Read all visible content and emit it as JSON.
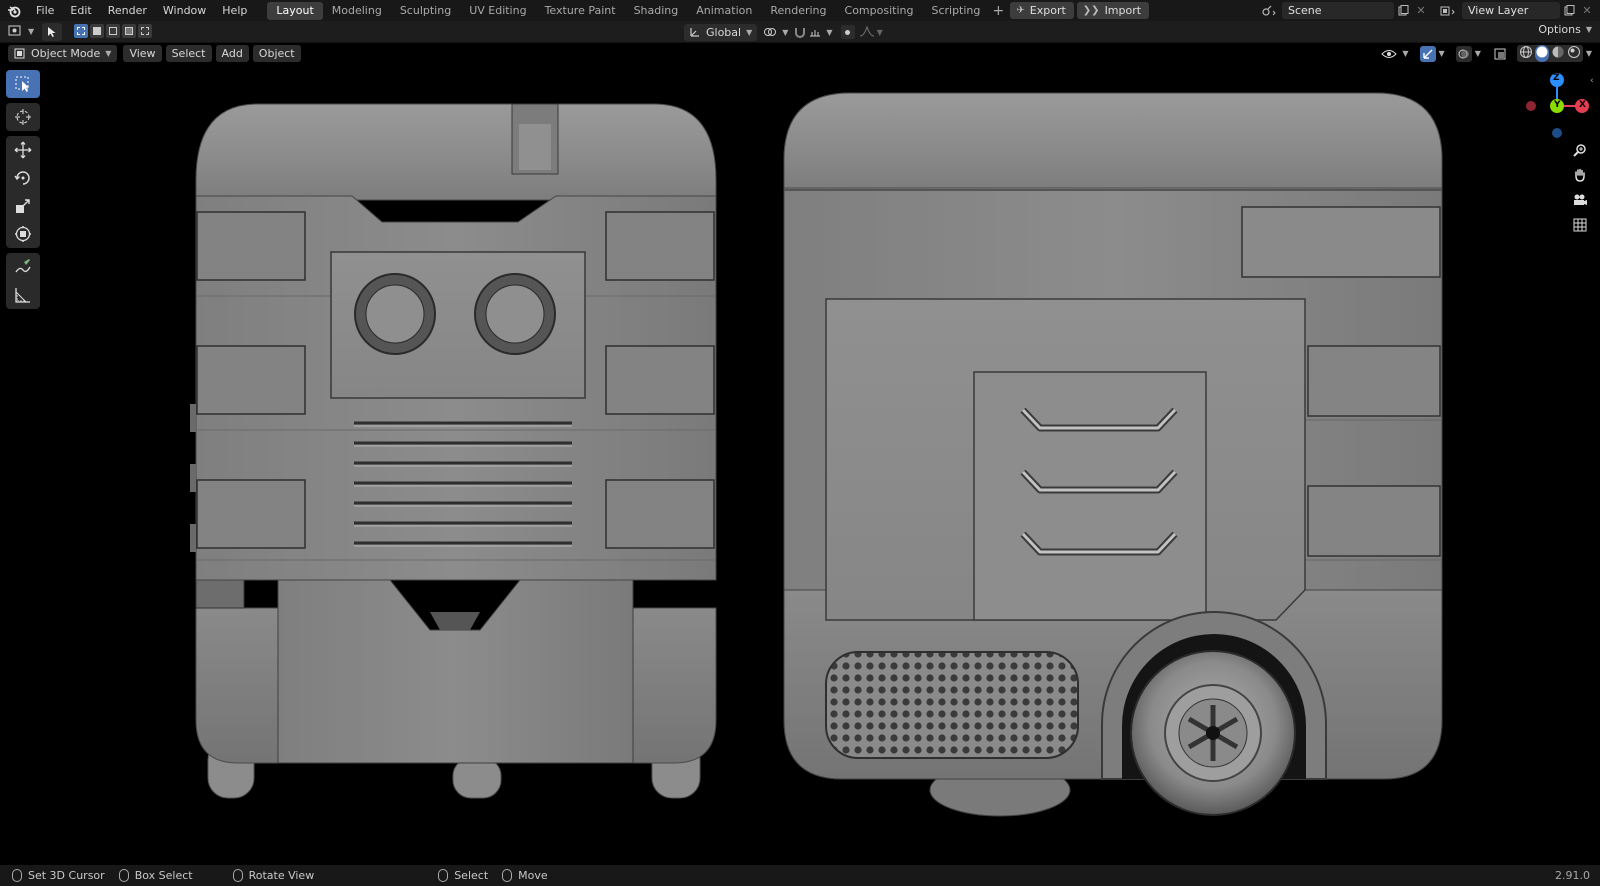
{
  "menu": [
    "File",
    "Edit",
    "Render",
    "Window",
    "Help"
  ],
  "workspaces": [
    "Layout",
    "Modeling",
    "Sculpting",
    "UV Editing",
    "Texture Paint",
    "Shading",
    "Animation",
    "Rendering",
    "Compositing",
    "Scripting"
  ],
  "active_workspace": "Layout",
  "top_buttons": {
    "export": "Export",
    "import": "Import"
  },
  "scene": {
    "value": "Scene"
  },
  "view_layer": {
    "value": "View Layer"
  },
  "header": {
    "mode": "Object Mode",
    "view": "View",
    "select": "Select",
    "add": "Add",
    "object": "Object",
    "transform_orientation": "Global",
    "options": "Options"
  },
  "gizmo": {
    "z": "Z",
    "y": "Y",
    "x": "X"
  },
  "status": {
    "set_cursor": "Set 3D Cursor",
    "box_select": "Box Select",
    "rotate_view": "Rotate View",
    "select": "Select",
    "move": "Move",
    "version": "2.91.0"
  },
  "colors": {
    "accent": "#4772b3",
    "axis_x": "#e53e52",
    "axis_y": "#8bdc00",
    "axis_z": "#2c8fff"
  }
}
